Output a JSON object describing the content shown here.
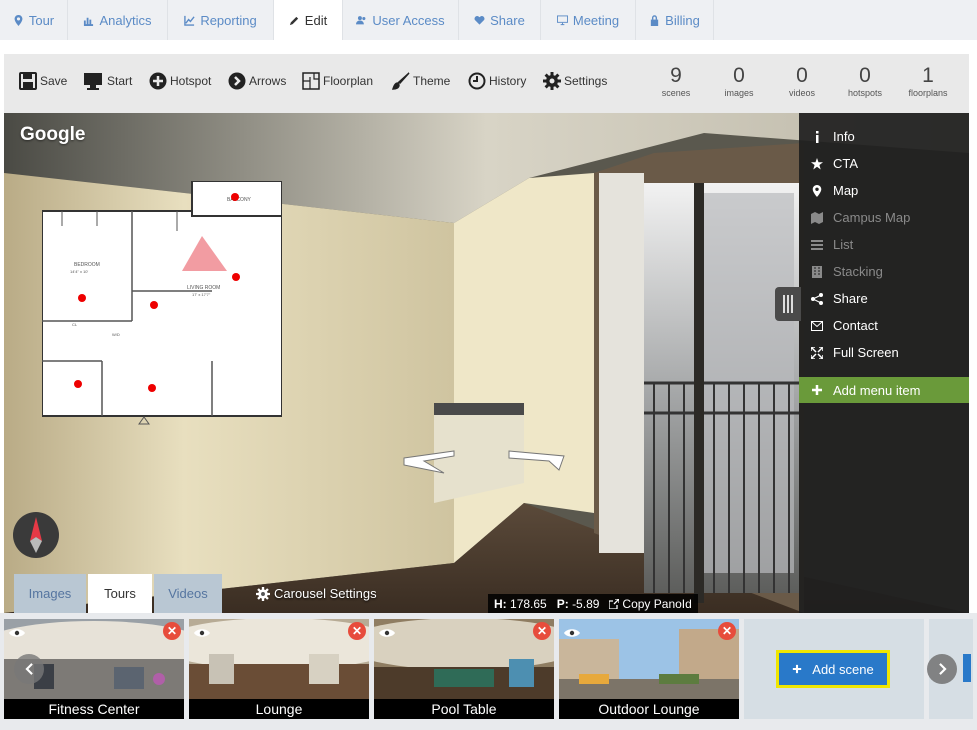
{
  "tabs": [
    {
      "label": "Tour",
      "icon": "map-marker-icon"
    },
    {
      "label": "Analytics",
      "icon": "bar-chart-icon"
    },
    {
      "label": "Reporting",
      "icon": "line-chart-icon"
    },
    {
      "label": "Edit",
      "icon": "pencil-icon"
    },
    {
      "label": "User Access",
      "icon": "users-icon"
    },
    {
      "label": "Share",
      "icon": "heart-icon"
    },
    {
      "label": "Meeting",
      "icon": "monitor-icon"
    },
    {
      "label": "Billing",
      "icon": "lock-icon"
    }
  ],
  "toolbar": {
    "save": "Save",
    "start": "Start",
    "hotspot": "Hotspot",
    "arrows": "Arrows",
    "floorplan": "Floorplan",
    "theme": "Theme",
    "history": "History",
    "settings": "Settings"
  },
  "stats": [
    {
      "value": "9",
      "label": "scenes"
    },
    {
      "value": "0",
      "label": "images"
    },
    {
      "value": "0",
      "label": "videos"
    },
    {
      "value": "0",
      "label": "hotspots"
    },
    {
      "value": "1",
      "label": "floorplans"
    }
  ],
  "viewer": {
    "watermark": "Google",
    "floorplan_labels": {
      "balcony": "BALCONY",
      "bedroom": "BEDROOM",
      "bedroom_size": "14'4\" x 10'",
      "living": "LIVING ROOM",
      "living_size": "17' x 17'7\"",
      "wd": "W/D",
      "cl": "CL"
    }
  },
  "side_menu": [
    {
      "label": "Info",
      "icon": "info-icon",
      "dim": false
    },
    {
      "label": "CTA",
      "icon": "star-icon",
      "dim": false
    },
    {
      "label": "Map",
      "icon": "map-marker-icon",
      "dim": false
    },
    {
      "label": "Campus Map",
      "icon": "map-icon",
      "dim": true
    },
    {
      "label": "List",
      "icon": "list-icon",
      "dim": true
    },
    {
      "label": "Stacking",
      "icon": "building-icon",
      "dim": true
    },
    {
      "label": "Share",
      "icon": "share-icon",
      "dim": false
    },
    {
      "label": "Contact",
      "icon": "envelope-icon",
      "dim": false
    },
    {
      "label": "Full Screen",
      "icon": "expand-icon",
      "dim": false
    }
  ],
  "add_menu_item": "Add menu item",
  "viewer_tabs": {
    "images": "Images",
    "tours": "Tours",
    "videos": "Videos",
    "carousel_settings": "Carousel Settings"
  },
  "coords": {
    "h_label": "H:",
    "h_value": "178.65",
    "p_label": "P:",
    "p_value": "-5.89",
    "copy": "Copy PanoId"
  },
  "scenes": [
    {
      "caption": "Fitness Center"
    },
    {
      "caption": "Lounge"
    },
    {
      "caption": "Pool Table"
    },
    {
      "caption": "Outdoor Lounge"
    }
  ],
  "add_scene": "Add scene",
  "colors": {
    "accent_blue": "#2979c9",
    "menu_green": "#6a9a3a",
    "delete_red": "#e74c3c",
    "tab_link": "#5b8bc6"
  }
}
